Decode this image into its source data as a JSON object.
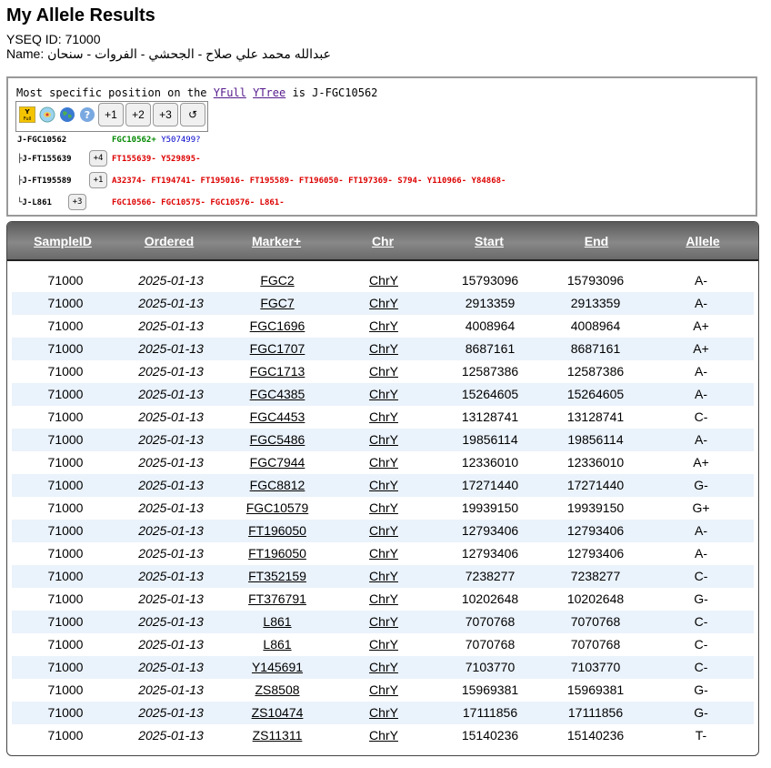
{
  "page": {
    "title": "My Allele Results",
    "yseq_id": "YSEQ ID: 71000",
    "name_label": "Name:",
    "name_value": "عبدالله محمد علي صلاح - الجحشي - الفروات - سنحان"
  },
  "tree": {
    "head_prefix": "Most specific position on the",
    "link_yfull": "YFull",
    "link_ytree": "YTree",
    "head_suffix": "is J-FGC10562",
    "toolbar": {
      "yfull_icon_label": "Y Full",
      "plus1": "+1",
      "plus2": "+2",
      "plus3": "+3",
      "reset": "↺"
    },
    "rows": [
      {
        "node": "J-FGC10562",
        "snps_pos": "FGC10562+",
        "snps_extra": "Y507499?"
      },
      {
        "node": "├J-FT155639",
        "badge": "+4",
        "snps": "FT155639- Y529895-"
      },
      {
        "node": "├J-FT195589",
        "badge": "+1",
        "snps": "A32374- FT194741- FT195016- FT195589- FT196050- FT197369- S794- Y110966- Y84868-"
      },
      {
        "node": "└J-L861",
        "badge": "+3",
        "snps": "FGC10566- FGC10575- FGC10576- L861-"
      }
    ]
  },
  "table": {
    "headers": [
      "SampleID",
      "Ordered",
      "Marker+",
      "Chr",
      "Start",
      "End",
      "Allele"
    ],
    "rows": [
      [
        "71000",
        "2025-01-13",
        "FGC2",
        "ChrY",
        "15793096",
        "15793096",
        "A-"
      ],
      [
        "71000",
        "2025-01-13",
        "FGC7",
        "ChrY",
        "2913359",
        "2913359",
        "A-"
      ],
      [
        "71000",
        "2025-01-13",
        "FGC1696",
        "ChrY",
        "4008964",
        "4008964",
        "A+"
      ],
      [
        "71000",
        "2025-01-13",
        "FGC1707",
        "ChrY",
        "8687161",
        "8687161",
        "A+"
      ],
      [
        "71000",
        "2025-01-13",
        "FGC1713",
        "ChrY",
        "12587386",
        "12587386",
        "A-"
      ],
      [
        "71000",
        "2025-01-13",
        "FGC4385",
        "ChrY",
        "15264605",
        "15264605",
        "A-"
      ],
      [
        "71000",
        "2025-01-13",
        "FGC4453",
        "ChrY",
        "13128741",
        "13128741",
        "C-"
      ],
      [
        "71000",
        "2025-01-13",
        "FGC5486",
        "ChrY",
        "19856114",
        "19856114",
        "A-"
      ],
      [
        "71000",
        "2025-01-13",
        "FGC7944",
        "ChrY",
        "12336010",
        "12336010",
        "A+"
      ],
      [
        "71000",
        "2025-01-13",
        "FGC8812",
        "ChrY",
        "17271440",
        "17271440",
        "G-"
      ],
      [
        "71000",
        "2025-01-13",
        "FGC10579",
        "ChrY",
        "19939150",
        "19939150",
        "G+"
      ],
      [
        "71000",
        "2025-01-13",
        "FT196050",
        "ChrY",
        "12793406",
        "12793406",
        "A-"
      ],
      [
        "71000",
        "2025-01-13",
        "FT196050",
        "ChrY",
        "12793406",
        "12793406",
        "A-"
      ],
      [
        "71000",
        "2025-01-13",
        "FT352159",
        "ChrY",
        "7238277",
        "7238277",
        "C-"
      ],
      [
        "71000",
        "2025-01-13",
        "FT376791",
        "ChrY",
        "10202648",
        "10202648",
        "G-"
      ],
      [
        "71000",
        "2025-01-13",
        "L861",
        "ChrY",
        "7070768",
        "7070768",
        "C-"
      ],
      [
        "71000",
        "2025-01-13",
        "L861",
        "ChrY",
        "7070768",
        "7070768",
        "C-"
      ],
      [
        "71000",
        "2025-01-13",
        "Y145691",
        "ChrY",
        "7103770",
        "7103770",
        "C-"
      ],
      [
        "71000",
        "2025-01-13",
        "ZS8508",
        "ChrY",
        "15969381",
        "15969381",
        "G-"
      ],
      [
        "71000",
        "2025-01-13",
        "ZS10474",
        "ChrY",
        "17111856",
        "17111856",
        "G-"
      ],
      [
        "71000",
        "2025-01-13",
        "ZS11311",
        "ChrY",
        "15140236",
        "15140236",
        "T-"
      ]
    ]
  }
}
